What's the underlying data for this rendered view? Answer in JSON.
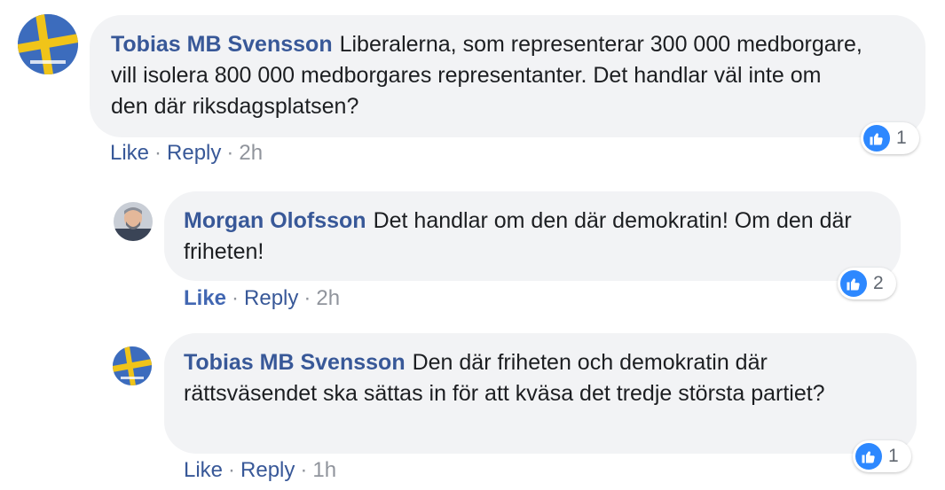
{
  "colors": {
    "author_link": "#385898",
    "bubble_bg": "#f2f3f5",
    "like_blue": "#2d88ff",
    "meta_gray": "#90949c"
  },
  "comments": [
    {
      "author": "Tobias MB Svensson",
      "text": "Liberalerna, som representerar 300 000 medborgare, vill isolera 800 000 medborgares representanter. Det handlar väl inte om den där riksdagsplatsen?",
      "avatar_icon": "swedish-flag-avatar",
      "like_label": "Like",
      "reply_label": "Reply",
      "time": "2h",
      "reaction_icon": "thumbs-up-icon",
      "reaction_count": "1"
    },
    {
      "author": "Morgan Olofsson",
      "text": "Det handlar om den där demokratin! Om den där friheten!",
      "avatar_icon": "person-avatar",
      "like_label": "Like",
      "reply_label": "Reply",
      "time": "2h",
      "reaction_icon": "thumbs-up-icon",
      "reaction_count": "2"
    },
    {
      "author": "Tobias MB Svensson",
      "text": "Den där friheten och demokratin där rättsväsendet ska sättas in för att kväsa det tredje största partiet?",
      "avatar_icon": "swedish-flag-avatar",
      "like_label": "Like",
      "reply_label": "Reply",
      "time": "1h",
      "reaction_icon": "thumbs-up-icon",
      "reaction_count": "1"
    }
  ]
}
